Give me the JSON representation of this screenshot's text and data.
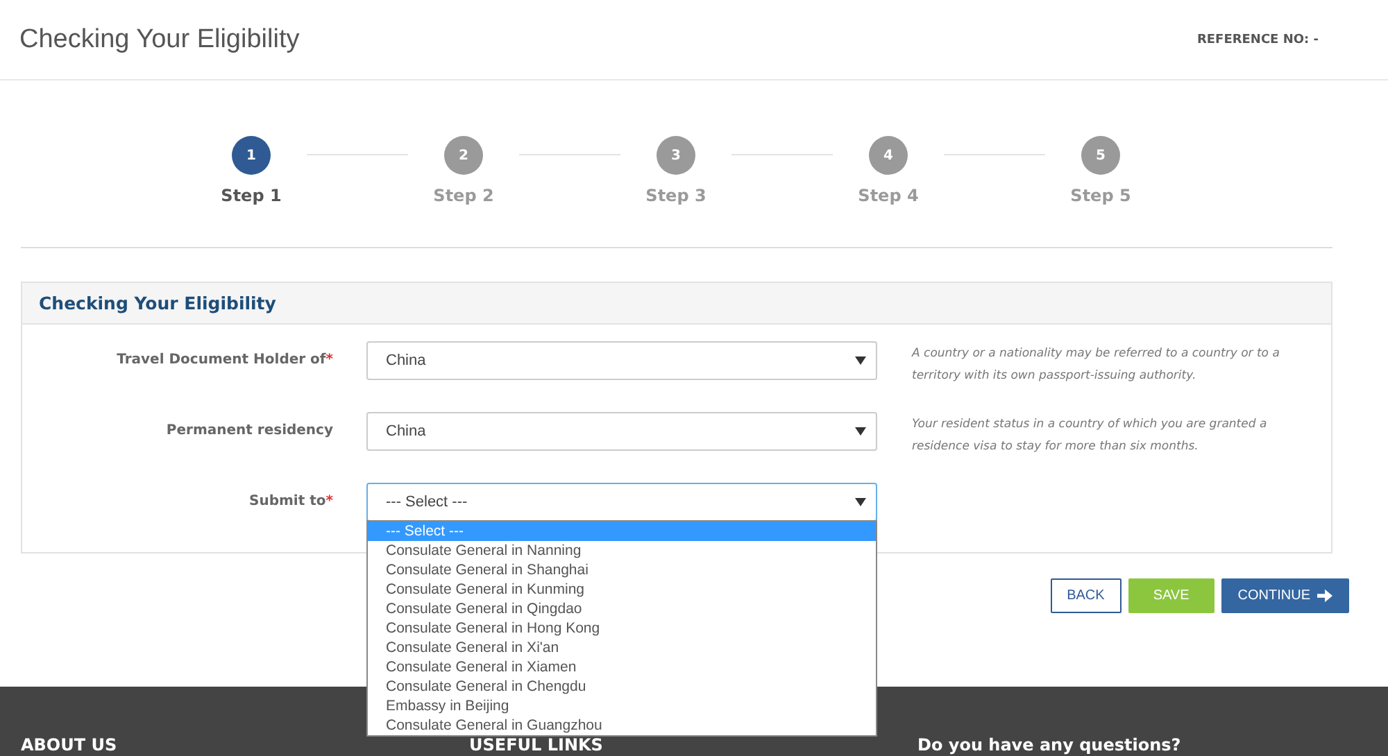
{
  "header": {
    "title": "Checking Your Eligibility",
    "reference": "REFERENCE NO: -"
  },
  "steps": [
    {
      "number": "1",
      "label": "Step 1",
      "selected": true
    },
    {
      "number": "2",
      "label": "Step 2",
      "selected": false
    },
    {
      "number": "3",
      "label": "Step 3",
      "selected": false
    },
    {
      "number": "4",
      "label": "Step 4",
      "selected": false
    },
    {
      "number": "5",
      "label": "Step 5",
      "selected": false
    }
  ],
  "panel": {
    "title": "Checking Your Eligibility",
    "fields": [
      {
        "label": "Travel Document Holder of",
        "required_mark": "*",
        "value": "China",
        "help": "A country or a nationality may be referred to a country or to a territory with its own passport-issuing authority.",
        "expanded": false
      },
      {
        "label": "Permanent residency",
        "value": "China",
        "help": "Your resident status in a country of which you are granted a residence visa to stay for more than six months.",
        "expanded": false
      },
      {
        "label": "Submit to",
        "required_mark": "*",
        "value": "--- Select ---",
        "expanded": true,
        "options": [
          {
            "label": "--- Select ---",
            "selected": true
          },
          {
            "label": "Consulate General in Nanning",
            "selected": false
          },
          {
            "label": "Consulate General in Shanghai",
            "selected": false
          },
          {
            "label": "Consulate General in Kunming",
            "selected": false
          },
          {
            "label": "Consulate General in Qingdao",
            "selected": false
          },
          {
            "label": "Consulate General in Hong Kong",
            "selected": false
          },
          {
            "label": "Consulate General in Xi'an",
            "selected": false
          },
          {
            "label": "Consulate General in Xiamen",
            "selected": false
          },
          {
            "label": "Consulate General in Chengdu",
            "selected": false
          },
          {
            "label": "Embassy in Beijing",
            "selected": false
          },
          {
            "label": "Consulate General in Guangzhou",
            "selected": false
          }
        ]
      }
    ]
  },
  "buttons": [
    {
      "label": "BACK",
      "kind": "outline"
    },
    {
      "label": "SAVE",
      "kind": "success"
    },
    {
      "label": "CONTINUE",
      "kind": "primary"
    }
  ],
  "footer": {
    "columns": [
      "ABOUT US",
      "USEFUL LINKS",
      "Do you have any questions?"
    ]
  }
}
